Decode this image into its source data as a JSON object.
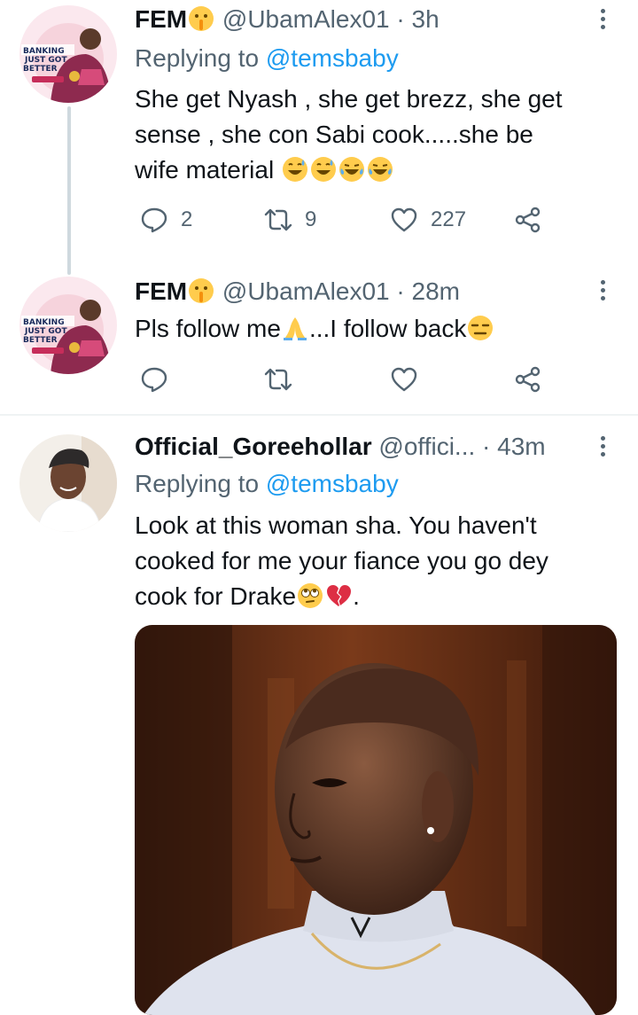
{
  "tweets": [
    {
      "name": "FEM",
      "handle": "@UbamAlex01",
      "time": "· 3h",
      "reply_prefix": "Replying to ",
      "reply_to": "@temsbaby",
      "text_1": "She get Nyash , she get brezz, she get",
      "text_2": "sense , she con Sabi cook.....she be",
      "text_3": "wife material",
      "name_emoji": "shushing-face",
      "text_emojis": [
        "grinning-sweat",
        "grinning-sweat",
        "tears-of-joy",
        "tears-of-joy"
      ],
      "replies": "2",
      "retweets": "9",
      "likes": "227",
      "avatar_text": [
        "BANKING",
        "JUST GOT",
        "BETTER"
      ]
    },
    {
      "name": "FEM",
      "handle": "@UbamAlex01",
      "time": "· 28m",
      "text_a": "Pls follow me",
      "text_b": "...I follow back",
      "name_emoji": "shushing-face",
      "emojis": [
        "folded-hands",
        "expressionless-face"
      ],
      "avatar_text": [
        "BANKING",
        "JUST GOT",
        "BETTER"
      ]
    },
    {
      "name": "Official_Goreehollar",
      "handle": "@offici...",
      "time": "· 43m",
      "reply_prefix": "Replying to ",
      "reply_to": "@temsbaby",
      "text_1": "Look at this woman sha. You haven't",
      "text_2": "cooked for me your fiance you go dey",
      "text_3": "cook for Drake",
      "text_end": ".",
      "emojis": [
        "face-with-rolling-eyes",
        "broken-heart"
      ]
    }
  ],
  "colors": {
    "accent": "#1d9bf0",
    "secondary_text": "#536471",
    "thread_line": "#cfd9de",
    "divider": "#eff3f4"
  }
}
